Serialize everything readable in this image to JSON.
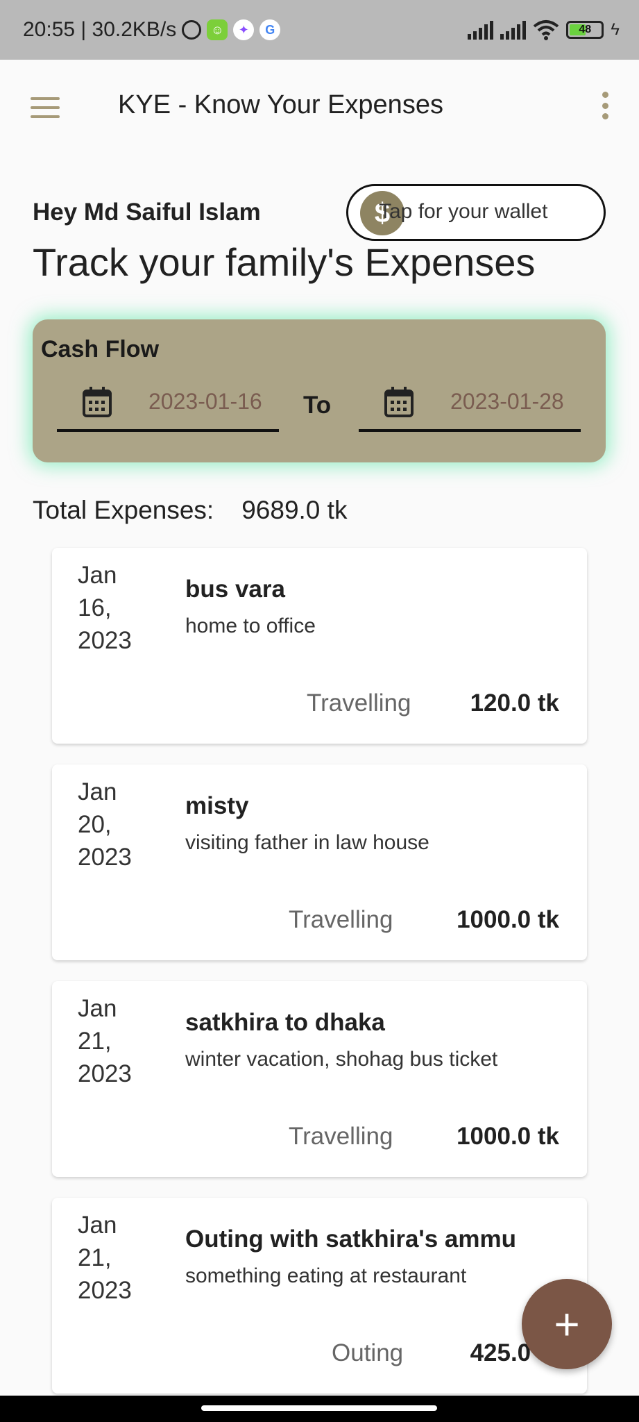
{
  "status_bar": {
    "time_speed": "20:55 | 30.2KB/s",
    "battery_level": "48"
  },
  "app_bar": {
    "title": "KYE - Know Your Expenses"
  },
  "greeting": "Hey Md Saiful Islam",
  "wallet_button": {
    "coin_symbol": "$",
    "label": "Tap for your wallet"
  },
  "headline": "Track your family's Expenses",
  "cash_flow": {
    "title": "Cash Flow",
    "from_date": "2023-01-16",
    "to_label": "To",
    "to_date": "2023-01-28"
  },
  "total": {
    "label": "Total Expenses:",
    "value": "9689.0 tk"
  },
  "expenses": [
    {
      "date_month_day": "Jan 16,",
      "date_year": "2023",
      "title": "bus vara",
      "description": "home to office",
      "category": "Travelling",
      "amount": "120.0 tk"
    },
    {
      "date_month_day": "Jan 20,",
      "date_year": "2023",
      "title": "misty",
      "description": "visiting father in law house",
      "category": "Travelling",
      "amount": "1000.0 tk"
    },
    {
      "date_month_day": "Jan 21,",
      "date_year": "2023",
      "title": "satkhira to dhaka",
      "description": "winter vacation, shohag bus ticket",
      "category": "Travelling",
      "amount": "1000.0 tk"
    },
    {
      "date_month_day": "Jan 21,",
      "date_year": "2023",
      "title": "Outing with satkhira's ammu",
      "description": "something eating at restaurant",
      "category": "Outing",
      "amount": "425.0 tk"
    }
  ],
  "fab": {
    "label": "+"
  },
  "colors": {
    "accent": "#a69a78",
    "card": "#aca487",
    "fab": "#7b5646",
    "date_text": "#7a5c50"
  }
}
